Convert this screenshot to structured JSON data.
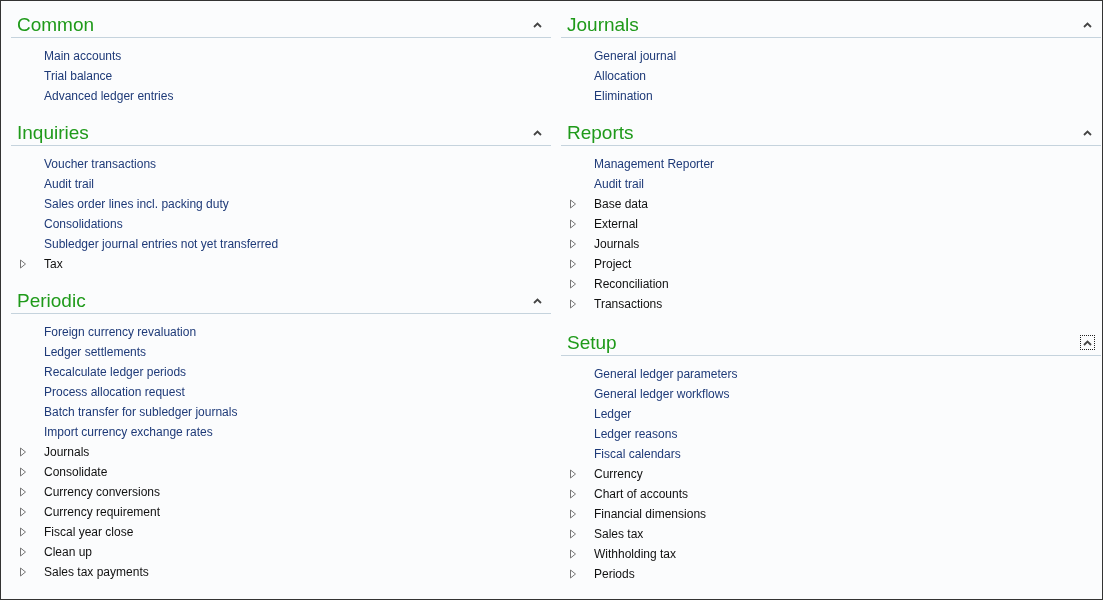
{
  "columns": [
    {
      "sections": [
        {
          "title": "Common",
          "expanded": true,
          "focused": false,
          "items": [
            {
              "kind": "link",
              "label": "Main accounts"
            },
            {
              "kind": "link",
              "label": "Trial balance"
            },
            {
              "kind": "link",
              "label": "Advanced ledger entries"
            }
          ]
        },
        {
          "title": "Inquiries",
          "expanded": true,
          "focused": false,
          "items": [
            {
              "kind": "link",
              "label": "Voucher transactions"
            },
            {
              "kind": "link",
              "label": "Audit trail"
            },
            {
              "kind": "link",
              "label": "Sales order lines incl. packing duty"
            },
            {
              "kind": "link",
              "label": "Consolidations"
            },
            {
              "kind": "link",
              "label": "Subledger journal entries not yet transferred"
            },
            {
              "kind": "folder",
              "label": "Tax"
            }
          ]
        },
        {
          "title": "Periodic",
          "expanded": true,
          "focused": false,
          "items": [
            {
              "kind": "link",
              "label": "Foreign currency revaluation"
            },
            {
              "kind": "link",
              "label": "Ledger settlements"
            },
            {
              "kind": "link",
              "label": "Recalculate ledger periods"
            },
            {
              "kind": "link",
              "label": "Process allocation request"
            },
            {
              "kind": "link",
              "label": "Batch transfer for subledger journals"
            },
            {
              "kind": "link",
              "label": "Import currency exchange rates"
            },
            {
              "kind": "folder",
              "label": "Journals"
            },
            {
              "kind": "folder",
              "label": "Consolidate"
            },
            {
              "kind": "folder",
              "label": "Currency conversions"
            },
            {
              "kind": "folder",
              "label": "Currency requirement"
            },
            {
              "kind": "folder",
              "label": "Fiscal year close"
            },
            {
              "kind": "folder",
              "label": "Clean up"
            },
            {
              "kind": "folder",
              "label": "Sales tax payments"
            }
          ]
        }
      ]
    },
    {
      "sections": [
        {
          "title": "Journals",
          "expanded": true,
          "focused": false,
          "items": [
            {
              "kind": "link",
              "label": "General journal"
            },
            {
              "kind": "link",
              "label": "Allocation"
            },
            {
              "kind": "link",
              "label": "Elimination"
            }
          ]
        },
        {
          "title": "Reports",
          "expanded": true,
          "focused": false,
          "items": [
            {
              "kind": "link",
              "label": "Management Reporter"
            },
            {
              "kind": "link",
              "label": "Audit trail"
            },
            {
              "kind": "folder",
              "label": "Base data"
            },
            {
              "kind": "folder",
              "label": "External"
            },
            {
              "kind": "folder",
              "label": "Journals"
            },
            {
              "kind": "folder",
              "label": "Project"
            },
            {
              "kind": "folder",
              "label": "Reconciliation"
            },
            {
              "kind": "folder",
              "label": "Transactions"
            }
          ]
        },
        {
          "title": "Setup",
          "expanded": true,
          "focused": true,
          "items": [
            {
              "kind": "link",
              "label": "General ledger parameters"
            },
            {
              "kind": "link",
              "label": "General ledger workflows"
            },
            {
              "kind": "link",
              "label": "Ledger"
            },
            {
              "kind": "link",
              "label": "Ledger reasons"
            },
            {
              "kind": "link",
              "label": "Fiscal calendars"
            },
            {
              "kind": "folder",
              "label": "Currency"
            },
            {
              "kind": "folder",
              "label": "Chart of accounts"
            },
            {
              "kind": "folder",
              "label": "Financial dimensions"
            },
            {
              "kind": "folder",
              "label": "Sales tax"
            },
            {
              "kind": "folder",
              "label": "Withholding tax"
            },
            {
              "kind": "folder",
              "label": "Periods"
            }
          ]
        }
      ]
    }
  ]
}
